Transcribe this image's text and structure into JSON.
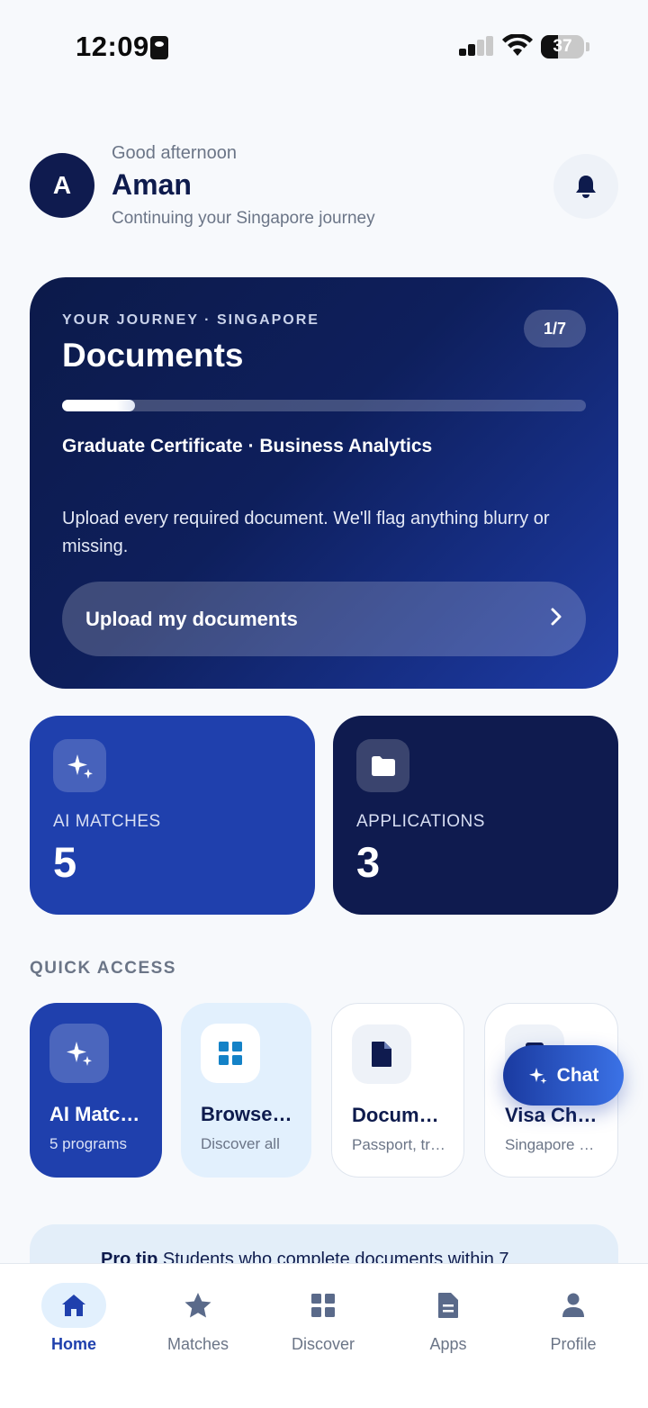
{
  "status_bar": {
    "time": "12:09",
    "battery": "37"
  },
  "header": {
    "avatar_initial": "A",
    "greeting": "Good afternoon",
    "name": "Aman",
    "subtitle": "Continuing your Singapore journey"
  },
  "hero": {
    "eyebrow": "YOUR JOURNEY · SINGAPORE",
    "step": "1/7",
    "title": "Documents",
    "progress_fraction": 0.14,
    "program": "Graduate Certificate · Business Analytics",
    "description": "Upload every required document. We'll flag anything blurry or missing.",
    "cta_label": "Upload my documents"
  },
  "stats": {
    "matches": {
      "label": "AI MATCHES",
      "value": "5"
    },
    "applications": {
      "label": "APPLICATIONS",
      "value": "3"
    }
  },
  "quick_access": {
    "title": "QUICK ACCESS",
    "items": [
      {
        "title": "AI Matches",
        "sub": "5 programs",
        "icon": "sparkle-icon"
      },
      {
        "title": "Browse programs",
        "sub": "Discover all",
        "icon": "grid-icon"
      },
      {
        "title": "Documents",
        "sub": "Passport, transcripts",
        "icon": "document-icon"
      },
      {
        "title": "Visa Checklist",
        "sub": "Singapore student pass",
        "icon": "visa-icon"
      }
    ]
  },
  "chat": {
    "label": "Chat"
  },
  "pro_tip": {
    "bold": "Pro tip",
    "text": " Students who complete documents within 7"
  },
  "nav": {
    "items": [
      {
        "label": "Home",
        "active": true
      },
      {
        "label": "Matches"
      },
      {
        "label": "Discover"
      },
      {
        "label": "Apps"
      },
      {
        "label": "Profile"
      }
    ]
  },
  "colors": {
    "navy": "#0f1b4f",
    "royal_blue": "#1f40ad",
    "light_blue": "#e2f0fd",
    "muted_text": "#6b7587"
  }
}
